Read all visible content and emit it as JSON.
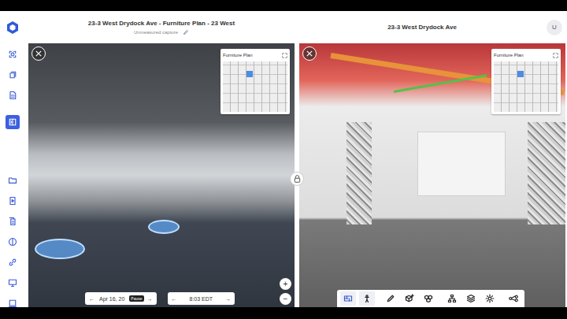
{
  "header": {
    "title": "23-3 West Drydock Ave - Furniture Plan - 23 West",
    "subtitle": "Unmeasured capture"
  },
  "compare_header": {
    "title": "23-3 West Drydock Ave",
    "avatar": "U"
  },
  "sidebar": {
    "items": [
      {
        "kind": "capture",
        "selected": false
      },
      {
        "kind": "pages",
        "selected": false
      },
      {
        "kind": "document",
        "selected": false
      },
      {
        "kind": "compare",
        "selected": true
      },
      {
        "kind": "folder",
        "selected": false
      },
      {
        "kind": "video",
        "selected": false
      },
      {
        "kind": "copy",
        "selected": false
      },
      {
        "kind": "contrast",
        "selected": false
      },
      {
        "kind": "link",
        "selected": false
      },
      {
        "kind": "screen",
        "selected": false
      },
      {
        "kind": "display",
        "selected": false
      }
    ]
  },
  "left_panel": {
    "minimap": {
      "title": "Furniture Plan"
    },
    "date": {
      "prev": "←",
      "label": "Apr 16, 20",
      "next": "→"
    },
    "tooltip": "Pause",
    "time": {
      "prev": "←",
      "label": "8:03 EDT",
      "next": "→"
    },
    "zoom": [
      "+",
      "−"
    ]
  },
  "right_panel": {
    "minimap": {
      "title": "Furniture Plan"
    },
    "toolbar": [
      {
        "kind": "floorplan",
        "selected": true
      },
      {
        "kind": "person",
        "selected": false
      },
      {
        "kind": "pencil",
        "selected": false
      },
      {
        "kind": "cube-add",
        "selected": false
      },
      {
        "kind": "cubes",
        "selected": false
      },
      {
        "kind": "hierarchy",
        "selected": false
      },
      {
        "kind": "layers",
        "selected": false
      },
      {
        "kind": "gear",
        "selected": false
      },
      {
        "kind": "expand",
        "selected": false
      }
    ]
  }
}
